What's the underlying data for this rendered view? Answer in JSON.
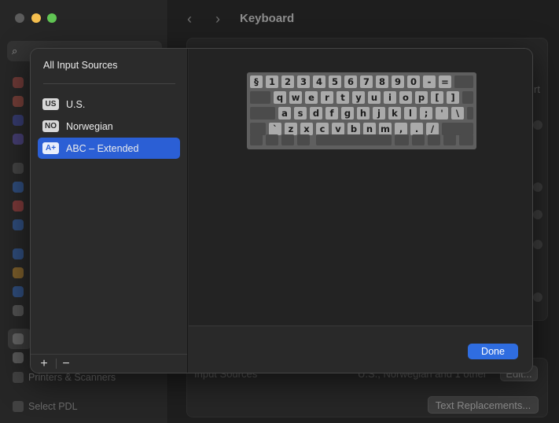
{
  "window": {
    "title": "Keyboard",
    "back_glyph": "‹",
    "forward_glyph": "›"
  },
  "background": {
    "sidebar_items": [
      {
        "label": "Printers & Scanners"
      },
      {
        "label": "Select PDL"
      }
    ],
    "input_sources_label": "Input Sources",
    "input_sources_value": "U.S., Norwegian and 1 other",
    "edit_button": "Edit...",
    "text_replacements_button": "Text Replacements...",
    "partial_text": "rt"
  },
  "sheet": {
    "header": "All Input Sources",
    "sources": [
      {
        "badge": "US",
        "label": "U.S.",
        "selected": false
      },
      {
        "badge": "NO",
        "label": "Norwegian",
        "selected": false
      },
      {
        "badge": "A+",
        "label": "ABC – Extended",
        "selected": true
      }
    ],
    "add_glyph": "+",
    "remove_glyph": "−",
    "done_label": "Done"
  },
  "keyboard": {
    "row1": [
      "§",
      "1",
      "2",
      "3",
      "4",
      "5",
      "6",
      "7",
      "8",
      "9",
      "0",
      "-",
      "="
    ],
    "row2": [
      "q",
      "w",
      "e",
      "r",
      "t",
      "y",
      "u",
      "i",
      "o",
      "p",
      "[",
      "]"
    ],
    "row3": [
      "a",
      "s",
      "d",
      "f",
      "g",
      "h",
      "j",
      "k",
      "l",
      ";",
      "'",
      "\\"
    ],
    "row4": [
      "`",
      "z",
      "x",
      "c",
      "v",
      "b",
      "n",
      "m",
      ",",
      ".",
      "/"
    ]
  },
  "colors": {
    "accent": "#2b5fd5",
    "done_button": "#2f6de0",
    "traffic_close": "#5c5c5c",
    "traffic_minimize": "#f5bf4f",
    "traffic_maximize": "#61c554"
  }
}
